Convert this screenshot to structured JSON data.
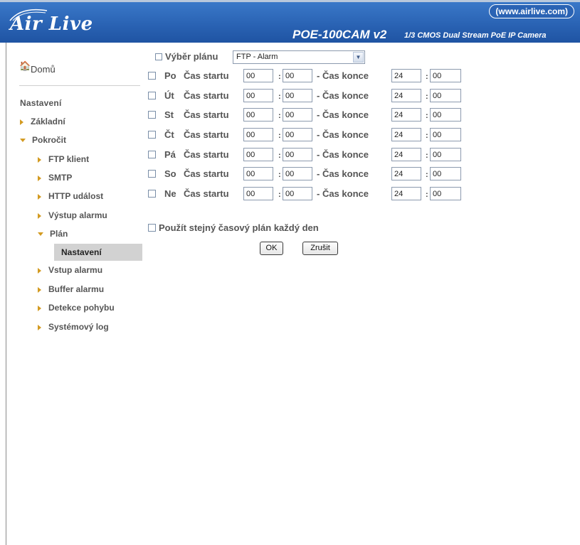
{
  "header": {
    "brand": "Air Live",
    "url": "(www.airlive.com)",
    "model": "POE-100CAM v2",
    "model_desc": "1/3 CMOS Dual Stream PoE IP Camera",
    "colors": {
      "bar": "#2a63b4",
      "text": "#ffffff"
    }
  },
  "sidebar": {
    "home": {
      "label": "Domů",
      "icon": "home-icon"
    },
    "settings_head": "Nastavení",
    "items": [
      {
        "label": "Základní"
      },
      {
        "label": "Pokročit"
      },
      {
        "label": "FTP klient"
      },
      {
        "label": "SMTP"
      },
      {
        "label": "HTTP událost"
      },
      {
        "label": "Výstup alarmu"
      },
      {
        "label": "Plán"
      },
      {
        "label": "Nastavení"
      },
      {
        "label": "Vstup alarmu"
      },
      {
        "label": "Buffer alarmu"
      },
      {
        "label": "Detekce pohybu"
      },
      {
        "label": "Systémový log"
      }
    ],
    "accent": "#d39b22"
  },
  "plan": {
    "label": "Výběr plánu",
    "selected": "FTP - Alarm"
  },
  "schedule": {
    "start_label": "Čas startu",
    "end_label": "- Čas konce",
    "days": [
      {
        "day": "Po",
        "start_h": "00",
        "start_m": "00",
        "end_h": "24",
        "end_m": "00"
      },
      {
        "day": "Út",
        "start_h": "00",
        "start_m": "00",
        "end_h": "24",
        "end_m": "00"
      },
      {
        "day": "St",
        "start_h": "00",
        "start_m": "00",
        "end_h": "24",
        "end_m": "00"
      },
      {
        "day": "Čt",
        "start_h": "00",
        "start_m": "00",
        "end_h": "24",
        "end_m": "00"
      },
      {
        "day": "Pá",
        "start_h": "00",
        "start_m": "00",
        "end_h": "24",
        "end_m": "00"
      },
      {
        "day": "So",
        "start_h": "00",
        "start_m": "00",
        "end_h": "24",
        "end_m": "00"
      },
      {
        "day": "Ne",
        "start_h": "00",
        "start_m": "00",
        "end_h": "24",
        "end_m": "00"
      }
    ],
    "colon": ":"
  },
  "same_plan_label": "Použít stejný časový plán každý den",
  "buttons": {
    "ok": "OK",
    "cancel": "Zrušit"
  }
}
